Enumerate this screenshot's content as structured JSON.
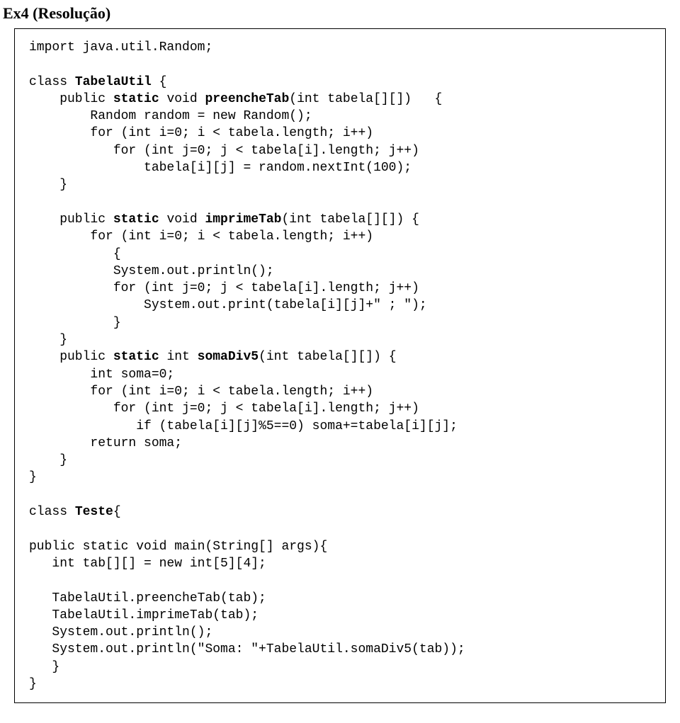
{
  "title": "Ex4 (Resolução)",
  "code": {
    "l01": "import java.util.Random;",
    "l02": "",
    "l03a": "class ",
    "l03b": "TabelaUtil",
    "l03c": " {",
    "l04a": "    public ",
    "l04b": "static",
    "l04c": " void ",
    "l04d": "preencheTab",
    "l04e": "(int tabela[][])   {",
    "l05": "        Random random = new Random();",
    "l06": "        for (int i=0; i < tabela.length; i++)",
    "l07": "           for (int j=0; j < tabela[i].length; j++)",
    "l08": "               tabela[i][j] = random.nextInt(100);",
    "l09": "    }",
    "l10": "",
    "l11a": "    public ",
    "l11b": "static",
    "l11c": " void ",
    "l11d": "imprimeTab",
    "l11e": "(int tabela[][]) {",
    "l12": "        for (int i=0; i < tabela.length; i++)",
    "l13": "           {",
    "l14": "           System.out.println();",
    "l15": "           for (int j=0; j < tabela[i].length; j++)",
    "l16": "               System.out.print(tabela[i][j]+\" ; \");",
    "l17": "           }",
    "l18": "    }",
    "l19a": "    public ",
    "l19b": "static",
    "l19c": " int ",
    "l19d": "somaDiv5",
    "l19e": "(int tabela[][]) {",
    "l20": "        int soma=0;",
    "l21": "        for (int i=0; i < tabela.length; i++)",
    "l22": "           for (int j=0; j < tabela[i].length; j++)",
    "l23": "              if (tabela[i][j]%5==0) soma+=tabela[i][j];",
    "l24": "        return soma;",
    "l25": "    }",
    "l26": "}",
    "l27": "",
    "l28a": "class ",
    "l28b": "Teste",
    "l28c": "{",
    "l29": "",
    "l30": "public static void main(String[] args){",
    "l31": "   int tab[][] = new int[5][4];",
    "l32": "",
    "l33": "   TabelaUtil.preencheTab(tab);",
    "l34": "   TabelaUtil.imprimeTab(tab);",
    "l35": "   System.out.println();",
    "l36": "   System.out.println(\"Soma: \"+TabelaUtil.somaDiv5(tab));",
    "l37": "   }",
    "l38": "}"
  }
}
